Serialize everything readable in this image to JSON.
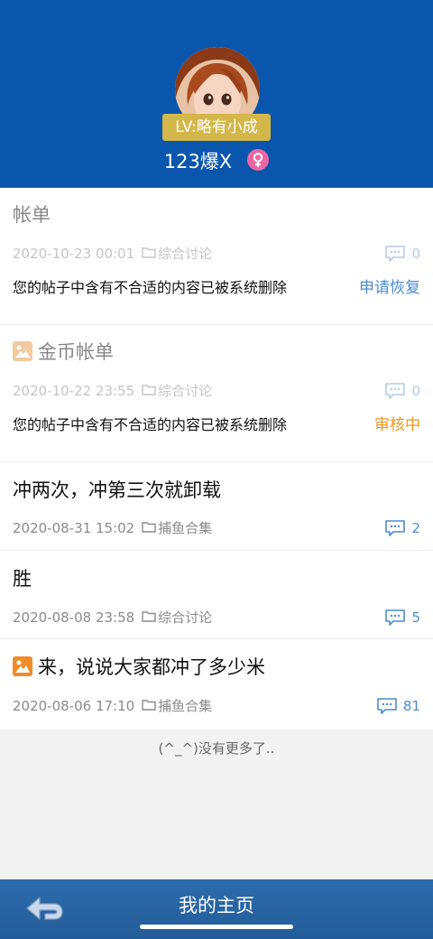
{
  "profile": {
    "level": "LV:略有小成",
    "username": "123爆X",
    "gender": "female"
  },
  "colors": {
    "header_bg": "#0b56ad",
    "level_badge": "#d4b74a",
    "gender_badge": "#ee66a3",
    "link_blue": "#4b8cd2",
    "status_orange": "#f0961c",
    "bottom_bar": "#2d6cad"
  },
  "posts": [
    {
      "title": "帐单",
      "has_image_icon": false,
      "date": "2020-10-23 00:01",
      "category": "综合讨论",
      "comments": "0",
      "notice": "您的帖子中含有不合适的内容已被系统删除",
      "status": "申请恢复"
    },
    {
      "title": "金币帐单",
      "has_image_icon": true,
      "date": "2020-10-22 23:55",
      "category": "综合讨论",
      "comments": "0",
      "notice": "您的帖子中含有不合适的内容已被系统删除",
      "status": "审核中"
    },
    {
      "title": "冲两次，冲第三次就卸载",
      "has_image_icon": false,
      "date": "2020-08-31 15:02",
      "category": "捕鱼合集",
      "comments": "2"
    },
    {
      "title": "胜",
      "has_image_icon": false,
      "date": "2020-08-08 23:58",
      "category": "综合讨论",
      "comments": "5"
    },
    {
      "title": "来，说说大家都冲了多少米",
      "has_image_icon": true,
      "date": "2020-08-06 17:10",
      "category": "捕鱼合集",
      "comments": "81"
    }
  ],
  "footer": {
    "no_more": "(^_^)没有更多了..",
    "page_title": "我的主页"
  },
  "icons": {
    "back": "back-arrow-icon",
    "folder": "folder-icon",
    "comment": "comment-bubble-icon",
    "image": "image-icon",
    "gender": "female-icon"
  }
}
